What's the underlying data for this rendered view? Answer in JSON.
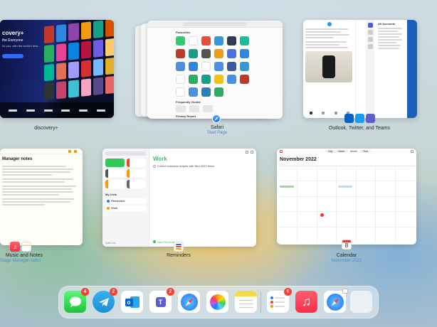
{
  "windows": {
    "discovery": {
      "label": "discovery+",
      "hero_heading": "covery+",
      "hero_subheading": "the Everyone",
      "hero_text": "for you, with the world's best..."
    },
    "safari": {
      "label": "Safari",
      "sublabel": "Start Page",
      "favourites_heading": "Favourites",
      "frequently_visited_heading": "Frequently Visited",
      "privacy_report_heading": "Privacy Report"
    },
    "outlook_group": {
      "label": "Outlook, Twitter, and Teams",
      "inbox_heading": "All Accounts"
    },
    "music_notes": {
      "label": "Music and Notes",
      "sublabel": "Stage Manager notes",
      "note_title": "Manager notes"
    },
    "reminders": {
      "label": "Reminders",
      "search_placeholder": "Search",
      "list_title": "Work",
      "reminder_text": "Collect business recipes with Bird 2023 items",
      "my_lists_heading": "My Lists",
      "list_1": "Reminders",
      "list_2": "Work",
      "new_reminder_label": "New Reminder",
      "add_list_label": "Add List"
    },
    "calendar": {
      "label": "Calendar",
      "sublabel": "November 2022",
      "month_title": "November 2022",
      "view_day": "Day",
      "view_week": "Week",
      "view_month": "Month",
      "view_year": "Year",
      "date_number": "8"
    }
  },
  "dock": {
    "badges": {
      "messages": "4",
      "telegram": "2",
      "teams": "2",
      "reminders": "6"
    }
  },
  "colors": {
    "accent": "#1d7bf5",
    "badge": "#ff3b30",
    "reminders_green": "#34c759"
  }
}
